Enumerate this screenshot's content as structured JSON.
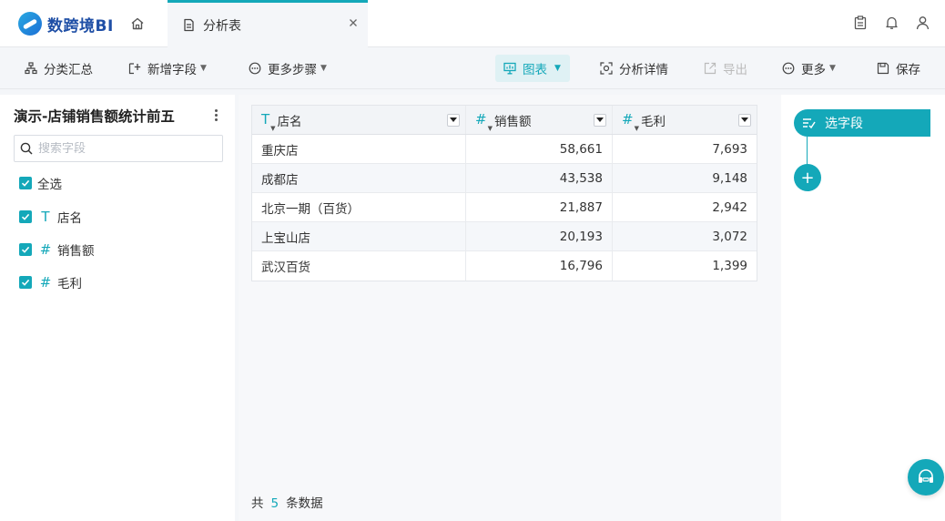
{
  "app": {
    "logo_text": "数跨境BI",
    "tab_label": "分析表",
    "tab_close": "×"
  },
  "toolbar": {
    "group_summary": "分类汇总",
    "add_field": "新增字段",
    "more_steps": "更多步骤",
    "chart": "图表",
    "analysis_detail": "分析详情",
    "export": "导出",
    "more": "更多",
    "save": "保存"
  },
  "left_panel": {
    "dataset_title": "演示-店铺销售额统计前五",
    "search_placeholder": "搜索字段",
    "select_all": "全选",
    "fields": [
      {
        "label": "店名",
        "type_icon": "text-type-icon",
        "type_glyph": "T"
      },
      {
        "label": "销售额",
        "type_icon": "number-type-icon",
        "type_glyph": "#"
      },
      {
        "label": "毛利",
        "type_icon": "number-type-icon",
        "type_glyph": "#"
      }
    ]
  },
  "table": {
    "columns": [
      {
        "label": "店名",
        "type_glyph": "T"
      },
      {
        "label": "销售额",
        "type_glyph": "#"
      },
      {
        "label": "毛利",
        "type_glyph": "#"
      }
    ],
    "rows": [
      [
        "重庆店",
        "58,661",
        "7,693"
      ],
      [
        "成都店",
        "43,538",
        "9,148"
      ],
      [
        "北京一期（百货）",
        "21,887",
        "2,942"
      ],
      [
        "上宝山店",
        "20,193",
        "3,072"
      ],
      [
        "武汉百货",
        "16,796",
        "1,399"
      ]
    ]
  },
  "footer": {
    "prefix": "共",
    "count": "5",
    "suffix": "条数据"
  },
  "steps": {
    "select_fields": "选字段",
    "add_symbol": "+"
  },
  "colors": {
    "accent": "#14a8b9",
    "brand": "#1f4fa6"
  }
}
